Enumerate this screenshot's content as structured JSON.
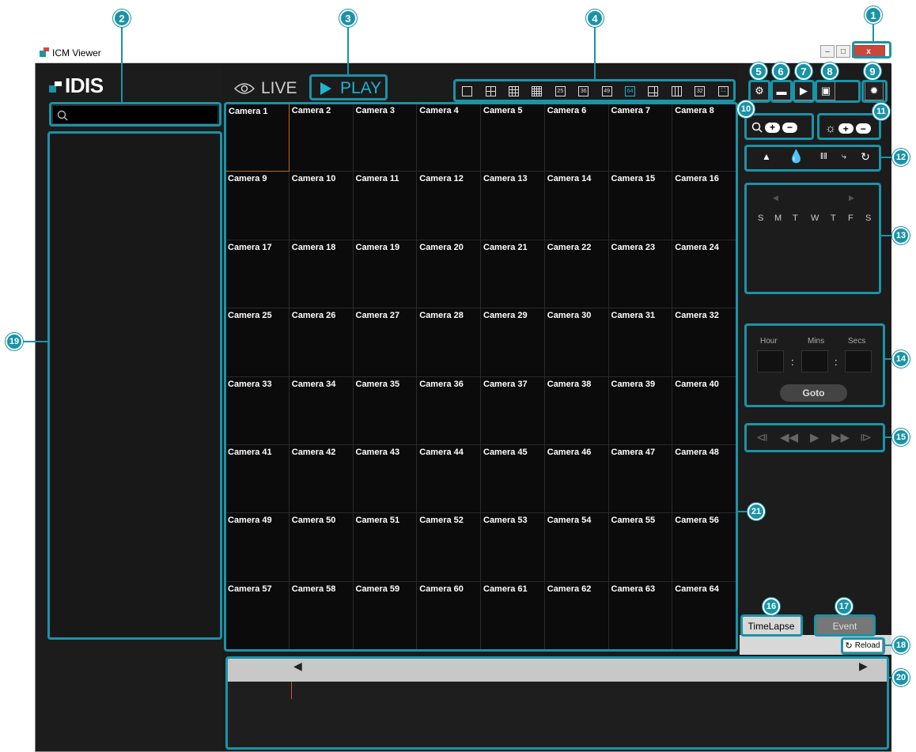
{
  "window": {
    "title": "ICM Viewer",
    "minimize": "–",
    "maximize": "□",
    "close": "x"
  },
  "logo": "IDIS",
  "modes": {
    "live": "LIVE",
    "play": "PLAY"
  },
  "search": {
    "placeholder": ""
  },
  "layouts": [
    "1x1",
    "2x2",
    "3x3",
    "4x4",
    "25",
    "36",
    "49",
    "64",
    "1+5",
    "1+12",
    "32",
    "fullscreen"
  ],
  "layout_labels": {
    "n25": "25",
    "n36": "36",
    "n49": "49",
    "n64": "64",
    "n32": "32"
  },
  "cameras": [
    "Camera 1",
    "Camera 2",
    "Camera 3",
    "Camera 4",
    "Camera 5",
    "Camera 6",
    "Camera 7",
    "Camera 8",
    "Camera 9",
    "Camera 10",
    "Camera 11",
    "Camera 12",
    "Camera 13",
    "Camera 14",
    "Camera 15",
    "Camera 16",
    "Camera 17",
    "Camera 18",
    "Camera 19",
    "Camera 20",
    "Camera 21",
    "Camera 22",
    "Camera 23",
    "Camera 24",
    "Camera 25",
    "Camera 26",
    "Camera 27",
    "Camera 28",
    "Camera 29",
    "Camera 30",
    "Camera 31",
    "Camera 32",
    "Camera 33",
    "Camera 34",
    "Camera 35",
    "Camera 36",
    "Camera 37",
    "Camera 38",
    "Camera 39",
    "Camera 40",
    "Camera 41",
    "Camera 42",
    "Camera 43",
    "Camera 44",
    "Camera 45",
    "Camera 46",
    "Camera 47",
    "Camera 48",
    "Camera 49",
    "Camera 50",
    "Camera 51",
    "Camera 52",
    "Camera 53",
    "Camera 54",
    "Camera 55",
    "Camera 56",
    "Camera 57",
    "Camera 58",
    "Camera 59",
    "Camera 60",
    "Camera 61",
    "Camera 62",
    "Camera 63",
    "Camera 64"
  ],
  "selected_camera": "Camera 1",
  "calendar": {
    "prev": "◀",
    "next": "▶",
    "days": [
      "S",
      "M",
      "T",
      "W",
      "T",
      "F",
      "S"
    ]
  },
  "time": {
    "hour_label": "Hour",
    "mins_label": "Mins",
    "secs_label": "Secs",
    "sep": ":",
    "goto": "Goto"
  },
  "tabs": {
    "timelapse": "TimeLapse",
    "event": "Event"
  },
  "reload": "Reload",
  "callouts": [
    "1",
    "2",
    "3",
    "4",
    "5",
    "6",
    "7",
    "8",
    "9",
    "10",
    "11",
    "12",
    "13",
    "14",
    "15",
    "16",
    "17",
    "18",
    "19",
    "20",
    "21"
  ],
  "colors": {
    "accent": "#1a93a8",
    "play": "#1fb4d4",
    "background": "#1b1b1b",
    "timeline_marker": "#e34a3a"
  }
}
